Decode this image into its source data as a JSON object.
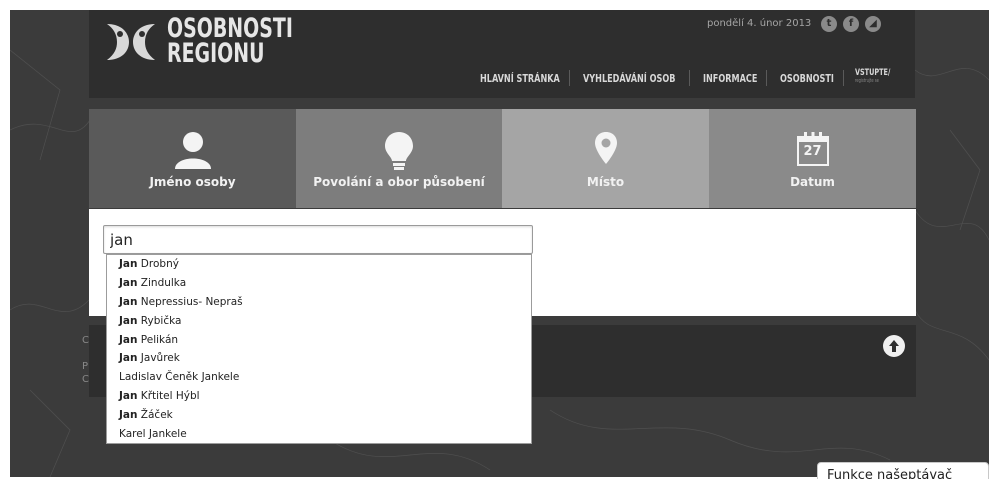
{
  "brand": {
    "line1": "OSOBNOSTI",
    "line2": "REGIONU"
  },
  "header": {
    "date": "pondělí 4. únor 2013",
    "social": [
      {
        "icon": "twitter-icon",
        "glyph": "t"
      },
      {
        "icon": "facebook-icon",
        "glyph": "f"
      },
      {
        "icon": "rss-icon",
        "glyph": "◢"
      }
    ]
  },
  "nav": {
    "items": [
      "HLAVNÍ STRÁNKA",
      "VYHLEDÁVÁNÍ OSOB",
      "INFORMACE",
      "OSOBNOSTI"
    ],
    "cta": "VSTUPTE/",
    "cta_sub": "registrujte se"
  },
  "tabs": [
    {
      "label": "Jméno osoby",
      "icon": "person-icon",
      "color": "#5a5a5a"
    },
    {
      "label": "Povolání a obor působení",
      "icon": "lightbulb-icon",
      "color": "#7d7d7d"
    },
    {
      "label": "Místo",
      "icon": "location-pin-icon",
      "color": "#a5a5a5"
    },
    {
      "label": "Datum",
      "icon": "calendar-icon",
      "color": "#8a8a8a",
      "calendar_day": "27"
    }
  ],
  "search": {
    "value": "jan"
  },
  "suggestions": [
    {
      "bold": "Jan",
      "rest": " Drobný"
    },
    {
      "bold": "Jan",
      "rest": " Zindulka"
    },
    {
      "bold": "Jan",
      "rest": " Nepressius- Nepraš"
    },
    {
      "bold": "Jan",
      "rest": " Rybička"
    },
    {
      "bold": "Jan",
      "rest": " Pelikán"
    },
    {
      "bold": "Jan",
      "rest": " Javůrek"
    },
    {
      "bold": "",
      "rest": "Ladislav Čeněk Jankele"
    },
    {
      "bold": "Jan",
      "rest": " Křtitel Hýbl"
    },
    {
      "bold": "Jan",
      "rest": " Žáček"
    },
    {
      "bold": "",
      "rest": "Karel Jankele"
    }
  ],
  "footer": {
    "l1": "C",
    "l2": "P",
    "l3": "C"
  },
  "tooltip": "Funkce našeptávač"
}
